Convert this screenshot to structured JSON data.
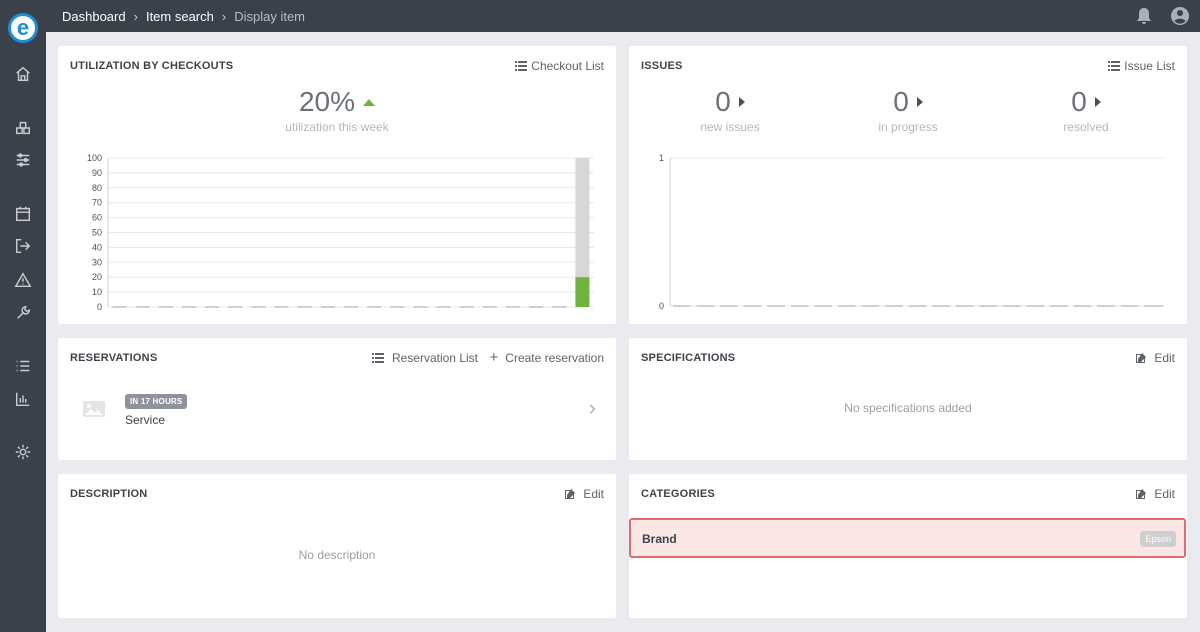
{
  "logo": {
    "letter": "e"
  },
  "sidebar": {
    "icons": [
      "home-icon",
      "boxes-icon",
      "sliders-icon",
      "calendar-icon",
      "checkout-icon",
      "warning-icon",
      "wrench-icon",
      "list-icon",
      "bar-chart-icon",
      "settings-icon"
    ]
  },
  "breadcrumb": {
    "items": [
      "Dashboard",
      "Item search",
      "Display item"
    ]
  },
  "utilization": {
    "title": "UTILIZATION BY CHECKOUTS",
    "action": "Checkout List",
    "stat": "20%",
    "stat_sub": "utilization this week",
    "trend_color": "#6fb43f"
  },
  "issues": {
    "title": "ISSUES",
    "action": "Issue List",
    "stats": [
      {
        "value": "0",
        "label": "new issues"
      },
      {
        "value": "0",
        "label": "in progress"
      },
      {
        "value": "0",
        "label": "resolved"
      }
    ]
  },
  "reservations": {
    "title": "RESERVATIONS",
    "list_action": "Reservation List",
    "create_action": "Create reservation",
    "item": {
      "badge": "IN 17 HOURS",
      "name": "Service"
    }
  },
  "specifications": {
    "title": "SPECIFICATIONS",
    "edit": "Edit",
    "empty": "No specifications added"
  },
  "description": {
    "title": "DESCRIPTION",
    "edit": "Edit",
    "empty": "No description"
  },
  "categories": {
    "title": "CATEGORIES",
    "edit": "Edit",
    "row": {
      "label": "Brand",
      "value": "Epson"
    },
    "highlight_color": "#e16a6a"
  },
  "chart_data": [
    {
      "type": "bar",
      "ylim": [
        0,
        100
      ],
      "yticks": [
        "0",
        "10",
        "20",
        "30",
        "40",
        "50",
        "60",
        "70",
        "80",
        "90",
        "100"
      ],
      "grid": true,
      "bar_count": 21,
      "values": [
        0,
        0,
        0,
        0,
        0,
        0,
        0,
        0,
        0,
        0,
        0,
        0,
        0,
        0,
        0,
        0,
        0,
        0,
        0,
        0,
        20
      ],
      "background_values": [
        0,
        0,
        0,
        0,
        0,
        0,
        0,
        0,
        0,
        0,
        0,
        0,
        0,
        0,
        0,
        0,
        0,
        0,
        0,
        0,
        100
      ],
      "colors": {
        "value": "#6fb43f",
        "background": "#d7d7d7"
      }
    },
    {
      "type": "line",
      "ylim": [
        0,
        1
      ],
      "yticks": [
        "0",
        "1"
      ],
      "grid": true,
      "values": [
        0,
        0,
        0,
        0,
        0,
        0,
        0,
        0,
        0,
        0,
        0,
        0,
        0,
        0,
        0,
        0,
        0,
        0,
        0,
        0,
        0
      ]
    }
  ]
}
